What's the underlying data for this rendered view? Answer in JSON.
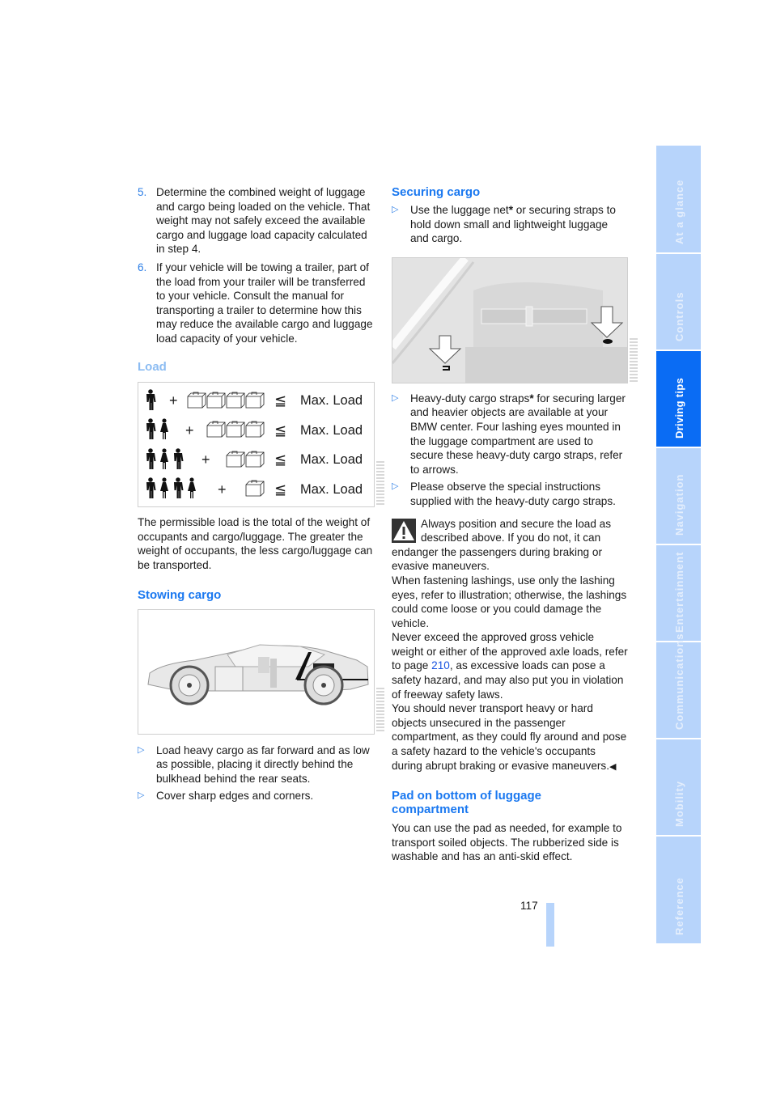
{
  "left_column": {
    "steps": [
      {
        "number": "5.",
        "text": "Determine the combined weight of luggage and cargo being loaded on the vehicle. That weight may not safely exceed the available cargo and luggage load capacity calculated in step 4."
      },
      {
        "number": "6.",
        "text": "If your vehicle will be towing a trailer, part of the load from your trailer will be transferred to your vehicle. Consult the manual for transporting a trailer to determine how this may reduce the available cargo and luggage load capacity of your vehicle."
      }
    ],
    "load_heading": "Load",
    "load_figure": {
      "rows": [
        {
          "occupants": 1,
          "suitcases": 4,
          "operator": "+",
          "comparison": "≦",
          "label": "Max. Load"
        },
        {
          "occupants": 2,
          "suitcases": 3,
          "operator": "+",
          "comparison": "≦",
          "label": "Max. Load"
        },
        {
          "occupants": 3,
          "suitcases": 2,
          "operator": "+",
          "comparison": "≦",
          "label": "Max. Load"
        },
        {
          "occupants": 4,
          "suitcases": 1,
          "operator": "+",
          "comparison": "≦",
          "label": "Max. Load"
        }
      ]
    },
    "load_paragraph": "The permissible load is the total of the weight of occupants and cargo/luggage. The greater the weight of occupants, the less cargo/luggage can be transported.",
    "stowing_heading": "Stowing cargo",
    "stowing_bullets": [
      "Load heavy cargo as far forward and as low as possible, placing it directly behind the bulkhead behind the rear seats.",
      "Cover sharp edges and corners."
    ]
  },
  "right_column": {
    "securing_heading": "Securing cargo",
    "securing_bullet_1_before": "Use the luggage net",
    "securing_bullet_1_after": " or securing straps to hold down small and lightweight luggage and cargo.",
    "asterisk": "*",
    "straps_bullet_before": "Heavy-duty cargo straps",
    "straps_bullet_after": " for securing larger and heavier objects are available at your BMW center. Four lashing eyes mounted in the luggage compartment are used to secure these heavy-duty cargo straps, refer to arrows.",
    "instructions_bullet": "Please observe the special instructions supplied with the heavy-duty cargo straps.",
    "warning": {
      "p1": "Always position and secure the load as described above. If you do not, it can endanger the passengers during braking or evasive maneuvers.",
      "p2": "When fastening lashings, use only the lashing eyes, refer to illustration; otherwise, the lashings could come loose or you could damage the vehicle.",
      "p3_before": "Never exceed the approved gross vehicle weight or either of the approved axle loads, refer to page ",
      "p3_link": "210",
      "p3_after": ", as excessive loads can pose a safety hazard, and may also put you in violation of freeway safety laws.",
      "p4": "You should never transport heavy or hard objects unsecured in the passenger compartment, as they could fly around and pose a safety hazard to the vehicle's occupants during abrupt braking or evasive maneuvers.",
      "end_mark": "◀"
    },
    "pad_heading": "Pad on bottom of luggage compartment",
    "pad_paragraph": "You can use the pad as needed, for example to transport soiled objects. The rubberized side is washable and has an anti-skid effect."
  },
  "side_tabs": [
    {
      "label": "At a glance",
      "active": false
    },
    {
      "label": "Controls",
      "active": false
    },
    {
      "label": "Driving tips",
      "active": true
    },
    {
      "label": "Navigation",
      "active": false
    },
    {
      "label": "Entertainment",
      "active": false
    },
    {
      "label": "Communications",
      "active": false
    },
    {
      "label": "Mobility",
      "active": false
    },
    {
      "label": "Reference",
      "active": false
    }
  ],
  "page_number": "117",
  "colors": {
    "accent": "#1a78f0",
    "tab_active": "#0a6cf4",
    "tab_inactive": "#b7d4fb",
    "link": "#1a54e0"
  }
}
